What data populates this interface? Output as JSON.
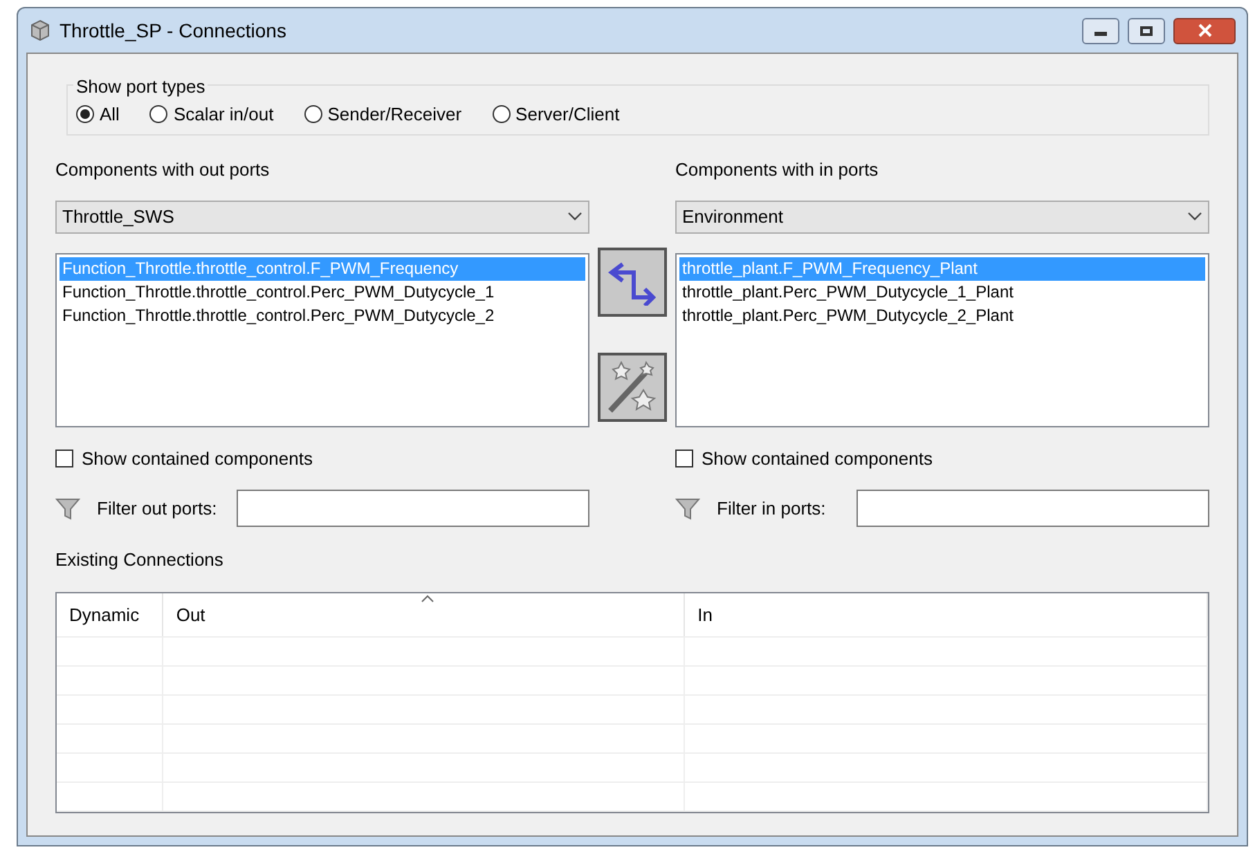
{
  "window": {
    "title": "Throttle_SP - Connections"
  },
  "port_types": {
    "label": "Show port types",
    "options": [
      {
        "label": "All",
        "selected": true
      },
      {
        "label": "Scalar in/out",
        "selected": false
      },
      {
        "label": "Sender/Receiver",
        "selected": false
      },
      {
        "label": "Server/Client",
        "selected": false
      }
    ]
  },
  "out_side": {
    "label": "Components with out ports",
    "component": "Throttle_SWS",
    "ports": [
      {
        "label": "Function_Throttle.throttle_control.F_PWM_Frequency",
        "selected": true
      },
      {
        "label": "Function_Throttle.throttle_control.Perc_PWM_Dutycycle_1",
        "selected": false
      },
      {
        "label": "Function_Throttle.throttle_control.Perc_PWM_Dutycycle_2",
        "selected": false
      }
    ],
    "show_contained": {
      "label": "Show contained components",
      "checked": false
    },
    "filter": {
      "label": "Filter out ports:"
    }
  },
  "in_side": {
    "label": "Components with in ports",
    "component": "Environment",
    "ports": [
      {
        "label": "throttle_plant.F_PWM_Frequency_Plant",
        "selected": true
      },
      {
        "label": "throttle_plant.Perc_PWM_Dutycycle_1_Plant",
        "selected": false
      },
      {
        "label": "throttle_plant.Perc_PWM_Dutycycle_2_Plant",
        "selected": false
      }
    ],
    "show_contained": {
      "label": "Show contained components",
      "checked": false
    },
    "filter": {
      "label": "Filter in ports:"
    }
  },
  "connections": {
    "label": "Existing Connections",
    "columns": [
      "Dynamic",
      "Out",
      "In"
    ]
  }
}
